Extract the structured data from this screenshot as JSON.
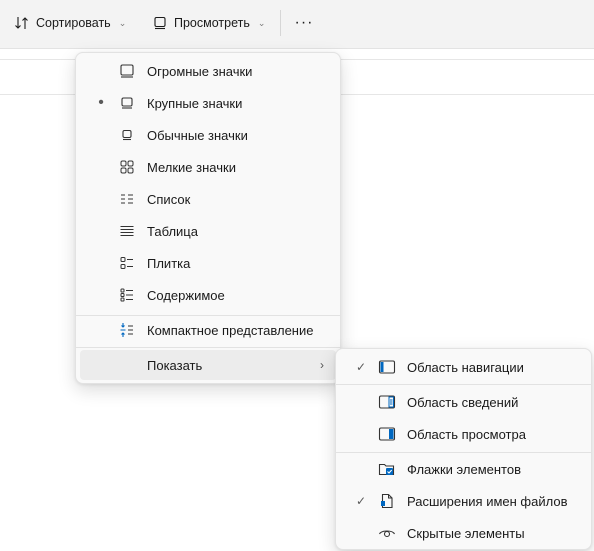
{
  "toolbar": {
    "sort_label": "Сортировать",
    "view_label": "Просмотреть",
    "more_label": "···"
  },
  "view_menu": {
    "items": [
      {
        "label": "Огромные значки",
        "icon": "extra-large-icons-icon",
        "selected": false
      },
      {
        "label": "Крупные значки",
        "icon": "large-icons-icon",
        "selected": true
      },
      {
        "label": "Обычные значки",
        "icon": "medium-icons-icon",
        "selected": false
      },
      {
        "label": "Мелкие значки",
        "icon": "small-icons-icon",
        "selected": false
      },
      {
        "label": "Список",
        "icon": "list-icon",
        "selected": false
      },
      {
        "label": "Таблица",
        "icon": "details-icon",
        "selected": false
      },
      {
        "label": "Плитка",
        "icon": "tiles-icon",
        "selected": false
      },
      {
        "label": "Содержимое",
        "icon": "content-icon",
        "selected": false
      }
    ],
    "compact_label": "Компактное представление",
    "show_label": "Показать",
    "selected_mark": "•"
  },
  "show_menu": {
    "items": [
      {
        "label": "Область навигации",
        "icon": "navigation-pane-icon",
        "checked": true
      },
      {
        "label": "Область сведений",
        "icon": "details-pane-icon",
        "checked": false
      },
      {
        "label": "Область просмотра",
        "icon": "preview-pane-icon",
        "checked": false
      },
      {
        "label": "Флажки элементов",
        "icon": "item-checkboxes-icon",
        "checked": false
      },
      {
        "label": "Расширения имен файлов",
        "icon": "file-extensions-icon",
        "checked": true
      },
      {
        "label": "Скрытые элементы",
        "icon": "hidden-items-icon",
        "checked": false
      }
    ],
    "check_mark": "✓"
  },
  "colors": {
    "accent": "#0067c0",
    "menu_bg": "#f9f9f9",
    "toolbar_bg": "#f3f3f3"
  }
}
